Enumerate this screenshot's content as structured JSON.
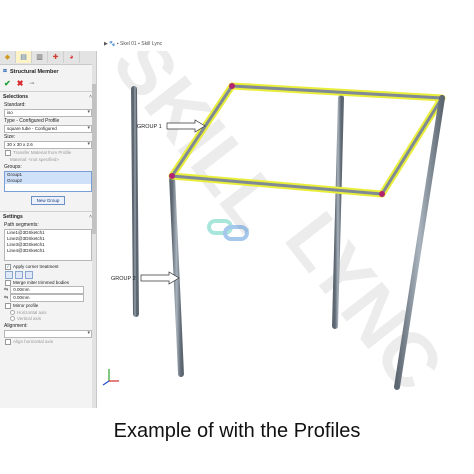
{
  "topbar": {
    "text": "▶ 🐾 ▪ Skel 01 ▪ Skill Lync"
  },
  "tabs": [
    {
      "icon": "feature-manager-icon"
    },
    {
      "icon": "property-manager-icon"
    },
    {
      "icon": "configuration-manager-icon"
    },
    {
      "icon": "dimxpert-icon"
    },
    {
      "icon": "display-manager-icon"
    }
  ],
  "pm": {
    "title": "Structural Member"
  },
  "selections": {
    "header": "Selections",
    "standard_label": "Standard:",
    "standard_value": "iso",
    "type_label": "Type - Configured Profile",
    "type_value": "square tube - Configured",
    "size_label": "Size:",
    "size_value": "30 x 30 x 2.6",
    "transfer_label": "Transfer Material from Profile",
    "material_label": "Material: <not specified>",
    "groups_label": "Groups:",
    "groups": [
      "Group1",
      "Group2"
    ],
    "new_group": "New Group"
  },
  "settings": {
    "header": "Settings",
    "path_label": "Path segments:",
    "segments": [
      "Line1@3DSketch1",
      "Line2@3DSketch1",
      "Line3@3DSketch1",
      "Line4@3DSketch1"
    ],
    "corner_label": "Apply corner treatment",
    "merge_label": "Merge miter trimmed bodies",
    "gap1": "0.00mm",
    "gap2": "0.00mm",
    "mirror_label": "Mirror profile",
    "horizontal_axis": "Horizontal axis",
    "vertical_axis": "Vertical axis",
    "alignment_label": "Alignment:",
    "align_horizontal": "Align horizontal axis"
  },
  "viewport": {
    "group1_label": "GROUP 1",
    "group2_label": "GROUP 2",
    "watermark_1": "SKILL",
    "watermark_2": "LYNC",
    "highlight_color": "#e9ee3a",
    "tube_color": "#7f8a96"
  },
  "caption": "Example of with the Profiles"
}
